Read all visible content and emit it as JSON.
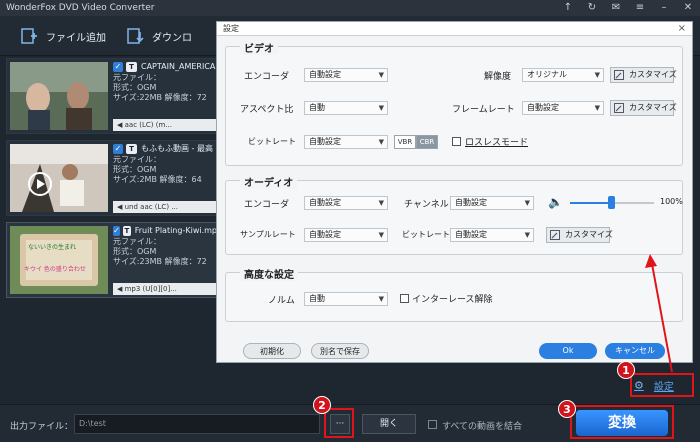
{
  "window": {
    "title": "WonderFox DVD Video Converter"
  },
  "toolbar": {
    "add_file": "ファイル追加",
    "download": "ダウンロ"
  },
  "files": [
    {
      "name": "CAPTAIN_AMERICA",
      "lines": [
        "元ファイル：",
        "形式：OGM",
        "サイズ:22MB  解像度：72"
      ],
      "audio": "aac (LC) (m..."
    },
    {
      "name": "もふもふ動画 - 最高",
      "lines": [
        "元ファイル：",
        "形式：OGM",
        "サイズ:2MB  解像度：64"
      ],
      "audio": "und aac (LC) ..."
    },
    {
      "name": "Fruit Plating-Kiwi.mp",
      "lines": [
        "元ファイル：",
        "形式：OGM",
        "サイズ:23MB  解像度：72"
      ],
      "audio": "mp3 (U[0][0]..."
    }
  ],
  "thumb_texts": {
    "t1": "ないいきの生まれ",
    "t2": "キウイ 色の盛り合わせ"
  },
  "dialog": {
    "title": "設定",
    "close": "×",
    "video": {
      "title": "ビデオ",
      "encoder_label": "エンコーダ",
      "encoder_value": "自動設定",
      "resolution_label": "解像度",
      "resolution_value": "オリジナル",
      "customize": "カスタマイズ",
      "aspect_label": "アスペクト比",
      "aspect_value": "自動",
      "framerate_label": "フレームレート",
      "framerate_value": "自動設定",
      "bitrate_label": "ビットレート",
      "bitrate_value": "自動設定",
      "vbr": "VBR",
      "cbr": "CBR",
      "lossless": "ロスレスモード"
    },
    "audio": {
      "title": "オーディオ",
      "encoder_label": "エンコーダ",
      "encoder_value": "自動設定",
      "channel_label": "チャンネル",
      "channel_value": "自動設定",
      "volume": "100%",
      "samplerate_label": "サンプルレート",
      "samplerate_value": "自動設定",
      "bitrate_label": "ビットレート",
      "bitrate_value": "自動設定",
      "customize": "カスタマイズ"
    },
    "advanced": {
      "title": "高度な設定",
      "norm_label": "ノルム",
      "norm_value": "自動",
      "deinterlace": "インターレース解除"
    },
    "init_btn": "初期化",
    "save_as_btn": "別名で保存",
    "ok_btn": "Ok",
    "cancel_btn": "キャンセル"
  },
  "bottom": {
    "output_label": "出力ファイル：",
    "output_path": "D:\\test",
    "browse": "···",
    "open": "開く",
    "merge": "すべての動画を結合",
    "settings": "設定",
    "convert": "変換"
  },
  "callouts": {
    "one": "1",
    "two": "2",
    "three": "3"
  },
  "colors": {
    "accent_blue": "#2b7fe0",
    "annotation_red": "#e0141b"
  }
}
